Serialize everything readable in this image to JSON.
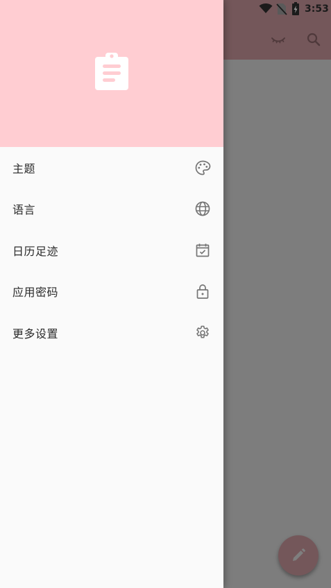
{
  "status_bar": {
    "time": "3:53"
  },
  "drawer": {
    "items": [
      {
        "label": "主题",
        "icon": "palette-icon"
      },
      {
        "label": "语言",
        "icon": "globe-icon"
      },
      {
        "label": "日历足迹",
        "icon": "calendar-check-icon"
      },
      {
        "label": "应用密码",
        "icon": "lock-icon"
      },
      {
        "label": "更多设置",
        "icon": "gear-icon"
      }
    ]
  },
  "colors": {
    "header_bg": "#ffcdd2",
    "accent": "#e8aeb4",
    "drawer_bg": "#fafafa",
    "icon_gray": "#757575"
  }
}
